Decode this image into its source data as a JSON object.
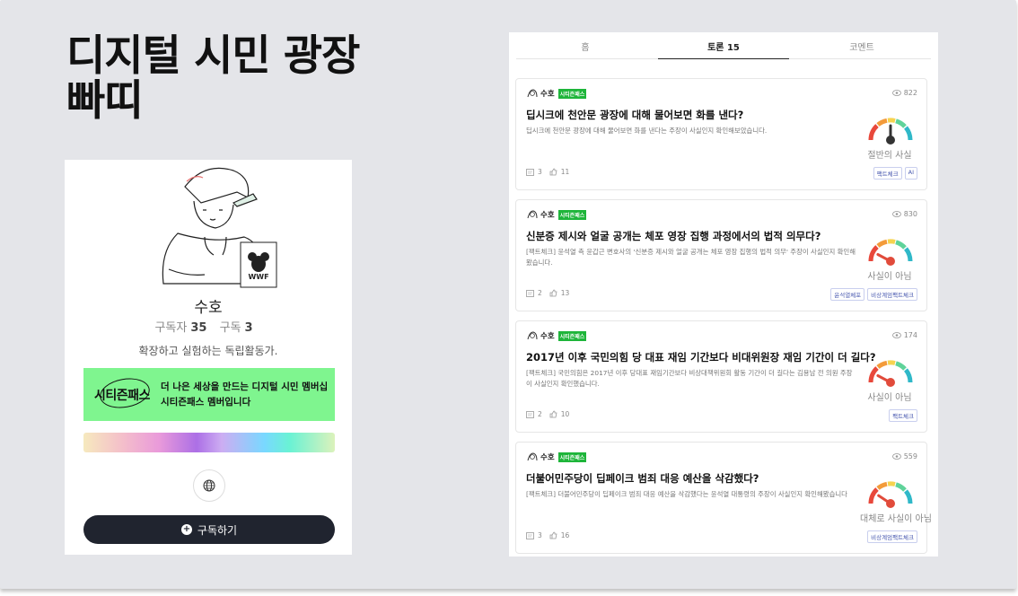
{
  "brand": {
    "line1": "디지털 시민 광장",
    "line2": "빠띠"
  },
  "profile": {
    "name": "수호",
    "subscribers_label": "구독자",
    "subscribers": "35",
    "subscriptions_label": "구독",
    "subscriptions": "3",
    "bio": "확장하고 실험하는 독립활동가.",
    "pass_logo": "시티즌패스",
    "pass_text": "더 나은 세상을 만드는 디지털 시민 멤버십 시티즌패스 멤버입니다",
    "avatar_badge": "WWF",
    "subscribe_label": "구독하기",
    "icons": {
      "globe": "globe-icon",
      "plus": "plus-circle-icon"
    }
  },
  "tabs": [
    {
      "label": "홈"
    },
    {
      "label": "토론 15"
    },
    {
      "label": "코멘트"
    }
  ],
  "posts": [
    {
      "author": "수호",
      "badge": "시티즌패스",
      "views": "822",
      "title": "딥시크에 천안문 광장에 대해 물어보면 화를 낸다?",
      "desc": "딥시크에 천안문 광장에 대해 물어보면 화를 낸다는 주장이 사실인지 확인해보았습니다.",
      "verdict": "절반의 사실",
      "comments": "3",
      "likes": "11",
      "tags": [
        "팩트체크",
        "AI"
      ]
    },
    {
      "author": "수호",
      "badge": "시티즌패스",
      "views": "830",
      "title": "신분증 제시와 얼굴 공개는 체포 영장 집행 과정에서의 법적 의무다?",
      "desc": "[팩트체크] 윤석열 측 윤갑근 변호사의 '신분증 제시와 얼굴 공개는 체포 영장 집행의 법적 의무' 주장이 사실인지 확인해봤습니다.",
      "verdict": "사실이 아님",
      "comments": "2",
      "likes": "13",
      "tags": [
        "윤석열체포",
        "비상계엄팩트체크"
      ]
    },
    {
      "author": "수호",
      "badge": "시티즌패스",
      "views": "174",
      "title": "2017년 이후 국민의힘 당 대표 재임 기간보다 비대위원장 재임 기간이 더 길다?",
      "desc": "[팩트체크] 국민의힘은 2017년 이후 당대표 재임기간보다 비상대책위원회 활동 기간이 더 길다는 김용남 전 의원 주장이 사실인지 확인했습니다.",
      "verdict": "사실이 아님",
      "comments": "2",
      "likes": "10",
      "tags": [
        "팩트체크"
      ]
    },
    {
      "author": "수호",
      "badge": "시티즌패스",
      "views": "559",
      "title": "더불어민주당이 딥페이크 범죄 대응 예산을 삭감했다?",
      "desc": "[팩트체크] 더불어민주당이 딥페이크 범죄 대응 예산을 삭감했다는 윤석열 대통령의 주장이 사실인지 확인해봤습니다",
      "verdict": "대체로 사실이 아님",
      "comments": "3",
      "likes": "16",
      "tags": [
        "비상계엄팩트체크"
      ]
    }
  ],
  "colors": {
    "gauge": [
      "#e8483b",
      "#f39b3a",
      "#f6d34f",
      "#5fd39a",
      "#2fb8c8"
    ],
    "badge": "#1eb53a",
    "pass_bg": "#7ff58f"
  }
}
